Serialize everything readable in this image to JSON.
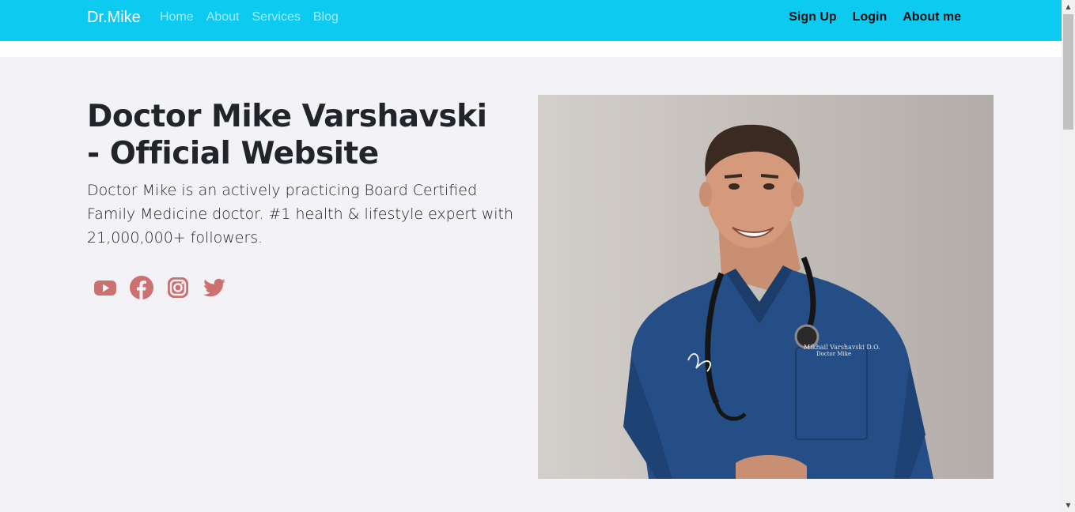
{
  "navbar": {
    "brand": "Dr.Mike",
    "links": [
      {
        "label": "Home"
      },
      {
        "label": "About"
      },
      {
        "label": "Services"
      },
      {
        "label": "Blog"
      }
    ],
    "right_links": [
      {
        "label": "Sign Up"
      },
      {
        "label": "Login"
      },
      {
        "label": "About me"
      }
    ],
    "bg_color": "#0dcaf0"
  },
  "hero": {
    "title": "Doctor Mike Varshavski - Official Website",
    "lead": "Doctor Mike is an actively practicing Board Certified Family Medicine doctor. #1 health & lifestyle expert with 21,000,000+ followers.",
    "social_icons": [
      "youtube-icon",
      "facebook-icon",
      "instagram-icon",
      "twitter-icon"
    ],
    "icon_color": "#cd7070",
    "photo": {
      "name_tag_line1": "Mikhail Varshavski D.O.",
      "name_tag_line2": "Doctor Mike"
    }
  }
}
